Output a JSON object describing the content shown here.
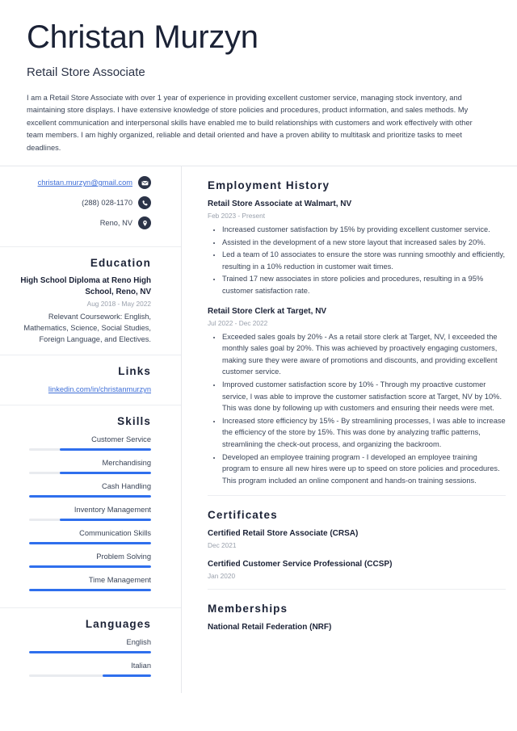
{
  "header": {
    "name": "Christan Murzyn",
    "job_title": "Retail Store Associate",
    "summary": "I am a Retail Store Associate with over 1 year of experience in providing excellent customer service, managing stock inventory, and maintaining store displays. I have extensive knowledge of store policies and procedures, product information, and sales methods. My excellent communication and interpersonal skills have enabled me to build relationships with customers and work effectively with other team members. I am highly organized, reliable and detail oriented and have a proven ability to multitask and prioritize tasks to meet deadlines."
  },
  "colors": {
    "accent": "#2f6fed",
    "heading": "#1b2236",
    "text": "#3a4457",
    "muted": "#9aa1ad",
    "link": "#3f6fd8",
    "icon_bg": "#2b3347",
    "divider": "#e6e8ec"
  },
  "contact": {
    "items": [
      {
        "text": "christan.murzyn@gmail.com",
        "icon": "envelope-icon",
        "is_link": true
      },
      {
        "text": "(288) 028-1170",
        "icon": "phone-icon",
        "is_link": false
      },
      {
        "text": "Reno, NV",
        "icon": "location-pin-icon",
        "is_link": false
      }
    ]
  },
  "education": {
    "heading": "Education",
    "entries": [
      {
        "title": "High School Diploma at Reno High School, Reno, NV",
        "date": "Aug 2018 - May 2022",
        "description": "Relevant Coursework: English, Mathematics, Science, Social Studies, Foreign Language, and Electives."
      }
    ]
  },
  "links": {
    "heading": "Links",
    "items": [
      {
        "text": "linkedin.com/in/christanmurzyn"
      }
    ]
  },
  "skills": {
    "heading": "Skills",
    "items": [
      {
        "label": "Customer Service",
        "level": 75
      },
      {
        "label": "Merchandising",
        "level": 75
      },
      {
        "label": "Cash Handling",
        "level": 100
      },
      {
        "label": "Inventory Management",
        "level": 75
      },
      {
        "label": "Communication Skills",
        "level": 100
      },
      {
        "label": "Problem Solving",
        "level": 100
      },
      {
        "label": "Time Management",
        "level": 100
      }
    ]
  },
  "languages": {
    "heading": "Languages",
    "items": [
      {
        "label": "English",
        "level": 100
      },
      {
        "label": "Italian",
        "level": 40
      }
    ]
  },
  "employment": {
    "heading": "Employment History",
    "entries": [
      {
        "title": "Retail Store Associate at Walmart, NV",
        "date": "Feb 2023 - Present",
        "bullets": [
          "Increased customer satisfaction by 15% by providing excellent customer service.",
          "Assisted in the development of a new store layout that increased sales by 20%.",
          "Led a team of 10 associates to ensure the store was running smoothly and efficiently, resulting in a 10% reduction in customer wait times.",
          "Trained 17 new associates in store policies and procedures, resulting in a 95% customer satisfaction rate."
        ]
      },
      {
        "title": "Retail Store Clerk at Target, NV",
        "date": "Jul 2022 - Dec 2022",
        "bullets": [
          "Exceeded sales goals by 20% - As a retail store clerk at Target, NV, I exceeded the monthly sales goal by 20%. This was achieved by proactively engaging customers, making sure they were aware of promotions and discounts, and providing excellent customer service.",
          "Improved customer satisfaction score by 10% - Through my proactive customer service, I was able to improve the customer satisfaction score at Target, NV by 10%. This was done by following up with customers and ensuring their needs were met.",
          "Increased store efficiency by 15% - By streamlining processes, I was able to increase the efficiency of the store by 15%. This was done by analyzing traffic patterns, streamlining the check-out process, and organizing the backroom.",
          "Developed an employee training program - I developed an employee training program to ensure all new hires were up to speed on store policies and procedures. This program included an online component and hands-on training sessions."
        ]
      }
    ]
  },
  "certificates": {
    "heading": "Certificates",
    "entries": [
      {
        "title": "Certified Retail Store Associate (CRSA)",
        "date": "Dec 2021"
      },
      {
        "title": "Certified Customer Service Professional (CCSP)",
        "date": "Jan 2020"
      }
    ]
  },
  "memberships": {
    "heading": "Memberships",
    "entries": [
      {
        "title": "National Retail Federation (NRF)",
        "date": ""
      }
    ]
  }
}
